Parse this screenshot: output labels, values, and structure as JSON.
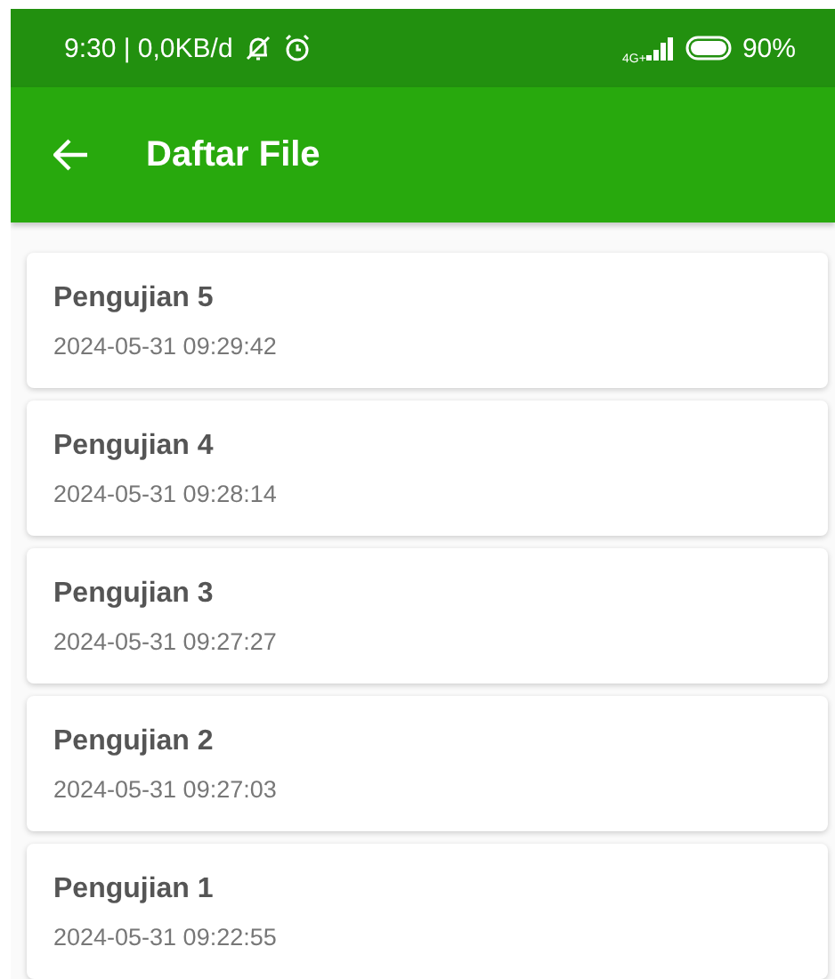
{
  "status_bar": {
    "time_data": "9:30 | 0,0KB/d",
    "network_type": "4G+",
    "battery": "90%"
  },
  "app_bar": {
    "title": "Daftar File"
  },
  "files": [
    {
      "name": "Pengujian 5",
      "date": "2024-05-31 09:29:42"
    },
    {
      "name": "Pengujian 4",
      "date": "2024-05-31 09:28:14"
    },
    {
      "name": "Pengujian 3",
      "date": "2024-05-31 09:27:27"
    },
    {
      "name": "Pengujian 2",
      "date": "2024-05-31 09:27:03"
    },
    {
      "name": "Pengujian 1",
      "date": "2024-05-31 09:22:55"
    }
  ]
}
